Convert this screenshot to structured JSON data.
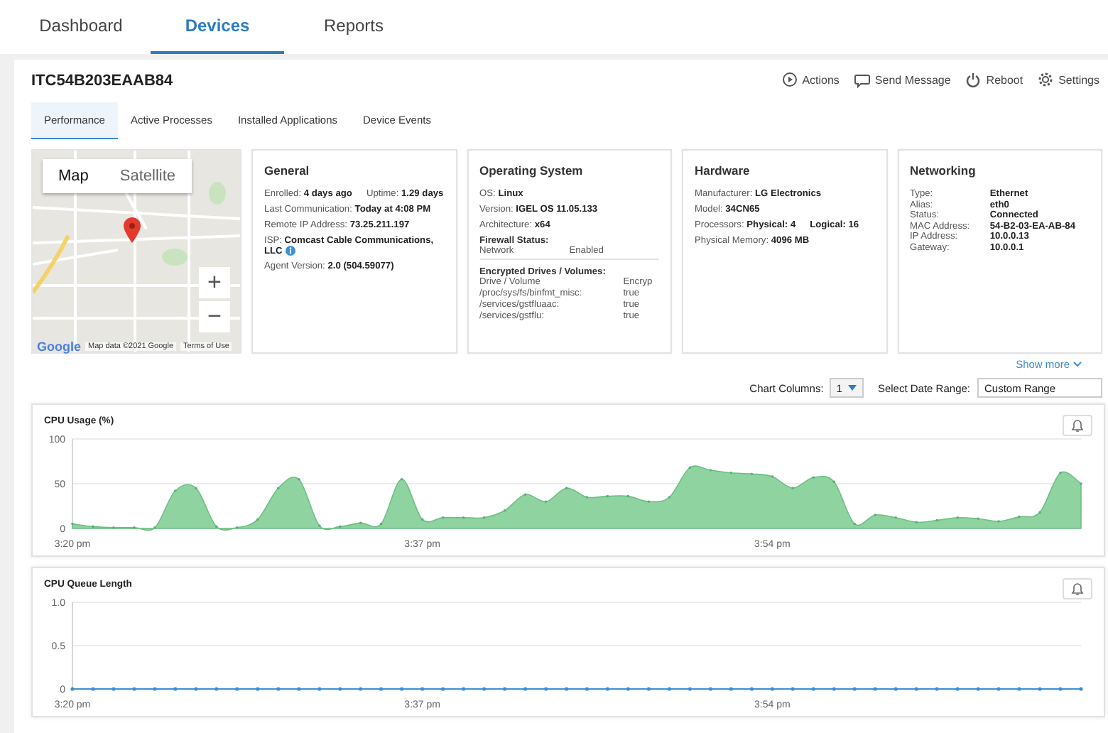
{
  "nav": {
    "tabs": [
      {
        "label": "Dashboard",
        "selected": false
      },
      {
        "label": "Devices",
        "selected": true
      },
      {
        "label": "Reports",
        "selected": false
      }
    ]
  },
  "device": {
    "name": "ITC54B203EAAB84",
    "actions": [
      {
        "kind": "play",
        "label": "Actions"
      },
      {
        "kind": "message",
        "label": "Send Message"
      },
      {
        "kind": "power",
        "label": "Reboot"
      },
      {
        "kind": "gear",
        "label": "Settings"
      }
    ]
  },
  "tabs": [
    {
      "label": "Performance",
      "selected": true
    },
    {
      "label": "Active Processes",
      "selected": false
    },
    {
      "label": "Installed Applications",
      "selected": false
    },
    {
      "label": "Device Events",
      "selected": false
    }
  ],
  "map": {
    "types": [
      {
        "label": "Map",
        "selected": true
      },
      {
        "label": "Satellite",
        "selected": false
      }
    ],
    "zoom_in": "+",
    "zoom_out": "−",
    "logo": "Google",
    "attribution": "Map data ©2021 Google",
    "terms": "Terms of Use"
  },
  "cards": [
    {
      "title": "General",
      "sections": [
        {
          "kind": "lines",
          "lines": [
            {
              "items": [
                "Enrolled: **4 days ago**",
                "Uptime: **1.29 days**"
              ]
            },
            {
              "items": [
                "Last Communication: **Today at 4:08 PM**"
              ]
            },
            {
              "items": [
                "Remote IP Address: **73.25.211.197**"
              ]
            },
            {
              "kind": "info",
              "items": [
                "ISP: **Comcast Cable Communications, LLC**"
              ]
            },
            {
              "items": [
                "Agent Version: **2.0 (504.59077)**"
              ]
            }
          ]
        }
      ]
    },
    {
      "title": "Operating System",
      "sections": [
        {
          "kind": "lines",
          "lines": [
            {
              "items": [
                "OS: **Linux**"
              ]
            },
            {
              "items": [
                "Version: **IGEL OS 11.05.133**"
              ]
            },
            {
              "items": [
                "Architecture: **x64**"
              ]
            }
          ]
        },
        {
          "kind": "table",
          "heading": "Firewall Status:",
          "rows": [
            [
              "Network",
              "Enabled"
            ]
          ]
        },
        {
          "kind": "table",
          "heading": "Encrypted Drives / Volumes:",
          "columns": [
            "Drive / Volume",
            "Encryp"
          ],
          "rows": [
            [
              "/proc/sys/fs/binfmt_misc:",
              "true"
            ],
            [
              "/services/gstfluaac:",
              "true"
            ],
            [
              "/services/gstflu:",
              "true"
            ]
          ]
        }
      ]
    },
    {
      "title": "Hardware",
      "sections": [
        {
          "kind": "lines",
          "lines": [
            {
              "items": [
                "Manufacturer: **LG Electronics**"
              ]
            },
            {
              "items": [
                "Model: **34CN65**"
              ]
            },
            {
              "items": [
                "Processors: **Physical: 4**",
                "**Logical: 16**"
              ]
            },
            {
              "items": [
                "Physical Memory: **4096 MB**"
              ]
            }
          ]
        }
      ]
    },
    {
      "title": "Networking",
      "sections": [
        {
          "kind": "pairs",
          "rows": [
            [
              "Type:",
              "Ethernet"
            ],
            [
              "Alias:",
              "eth0"
            ],
            [
              "Status:",
              "Connected"
            ],
            [
              "MAC Address:",
              "54-B2-03-EA-AB-84"
            ],
            [
              "IP Address:",
              "10.0.0.13"
            ],
            [
              "Gateway:",
              "10.0.0.1"
            ]
          ]
        }
      ]
    }
  ],
  "show_more": "Show more",
  "chart_controls": {
    "columns_label": "Chart Columns:",
    "columns_value": "1",
    "range_label": "Select Date Range:",
    "range_value": "Custom Range"
  },
  "charts": [
    {
      "title": "CPU Usage (%)",
      "chart_data": {
        "type": "area",
        "categories": [
          "3:20 pm",
          null,
          null,
          null,
          null,
          null,
          null,
          null,
          null,
          null,
          null,
          null,
          null,
          null,
          null,
          null,
          null,
          "3:37 pm",
          null,
          null,
          null,
          null,
          null,
          null,
          null,
          null,
          null,
          null,
          null,
          null,
          null,
          null,
          null,
          null,
          "3:54 pm",
          null,
          null,
          null,
          null,
          null,
          null,
          null,
          null,
          null,
          null,
          null,
          null,
          null,
          null,
          null
        ],
        "ylim": [
          0,
          100
        ],
        "yticks": [
          0,
          50,
          100
        ],
        "series": [
          {
            "color": "#8fd3a0",
            "values": [
              5,
              2,
              1,
              1,
              1,
              42,
              45,
              2,
              1,
              10,
              45,
              55,
              3,
              2,
              6,
              5,
              55,
              10,
              12,
              12,
              12,
              20,
              38,
              30,
              45,
              35,
              36,
              36,
              30,
              35,
              68,
              65,
              62,
              61,
              58,
              45,
              57,
              52,
              5,
              15,
              12,
              7,
              9,
              12,
              11,
              8,
              13,
              18,
              62,
              50
            ]
          }
        ]
      }
    },
    {
      "title": "CPU Queue Length",
      "chart_data": {
        "type": "line",
        "categories": [
          "3:20 pm",
          null,
          null,
          null,
          null,
          null,
          null,
          null,
          null,
          null,
          null,
          null,
          null,
          null,
          null,
          null,
          null,
          "3:37 pm",
          null,
          null,
          null,
          null,
          null,
          null,
          null,
          null,
          null,
          null,
          null,
          null,
          null,
          null,
          null,
          null,
          "3:54 pm",
          null,
          null,
          null,
          null,
          null,
          null,
          null,
          null,
          null,
          null,
          null,
          null,
          null,
          null,
          null
        ],
        "ylim": [
          0,
          1
        ],
        "yticks": [
          {
            "value": 0,
            "label": "0"
          },
          {
            "value": 0.5,
            "label": "0.5"
          },
          {
            "value": 1,
            "label": "1.0"
          }
        ],
        "series": [
          {
            "color": "#3b8fd4",
            "values": [
              0,
              0,
              0,
              0,
              0,
              0,
              0,
              0,
              0,
              0,
              0,
              0,
              0,
              0,
              0,
              0,
              0,
              0,
              0,
              0,
              0,
              0,
              0,
              0,
              0,
              0,
              0,
              0,
              0,
              0,
              0,
              0,
              0,
              0,
              0,
              0,
              0,
              0,
              0,
              0,
              0,
              0,
              0,
              0,
              0,
              0,
              0,
              0,
              0,
              0
            ]
          }
        ]
      }
    }
  ]
}
